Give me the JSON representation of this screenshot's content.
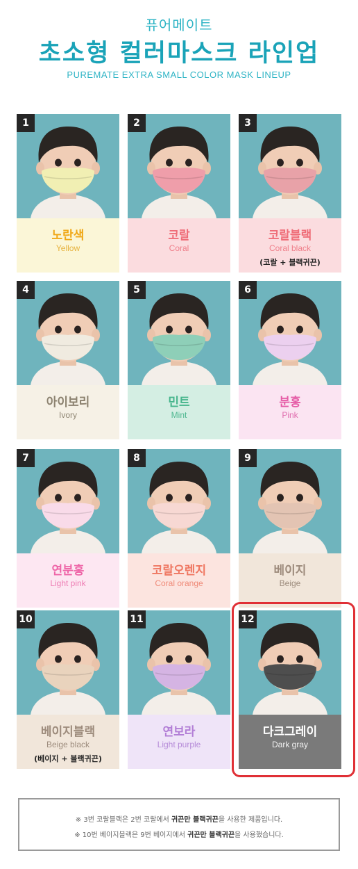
{
  "header": {
    "subtitle": "퓨어메이트",
    "title": "초소형 컬러마스크 라인업",
    "title_en": "PUREMATE EXTRA SMALL COLOR MASK LINEUP"
  },
  "masks": [
    {
      "num": "1",
      "name_ko": "노란색",
      "name_en": "Yellow",
      "note": "",
      "mask_color": "#f1efb3",
      "label_bg": "#fbf6d7",
      "ko_color": "#f0a818",
      "en_color": "#e6b23e"
    },
    {
      "num": "2",
      "name_ko": "코랄",
      "name_en": "Coral",
      "note": "",
      "mask_color": "#ef9eaa",
      "label_bg": "#fbdcdf",
      "ko_color": "#ef6d78",
      "en_color": "#ef7f8a"
    },
    {
      "num": "3",
      "name_ko": "코랄블랙",
      "name_en": "Coral black",
      "note": "(코랄 + 블랙귀끈)",
      "mask_color": "#e8a2a8",
      "label_bg": "#fbdcdf",
      "ko_color": "#ef6d78",
      "en_color": "#ef7f8a"
    },
    {
      "num": "4",
      "name_ko": "아이보리",
      "name_en": "Ivory",
      "note": "",
      "mask_color": "#f0ebe0",
      "label_bg": "#f6f1e6",
      "ko_color": "#8c8270",
      "en_color": "#8f8674"
    },
    {
      "num": "5",
      "name_ko": "민트",
      "name_en": "Mint",
      "note": "",
      "mask_color": "#8ecfb8",
      "label_bg": "#d4eee3",
      "ko_color": "#46b58c",
      "en_color": "#50b891"
    },
    {
      "num": "6",
      "name_ko": "분홍",
      "name_en": "Pink",
      "note": "",
      "mask_color": "#ecd0ef",
      "label_bg": "#fbe4f2",
      "ko_color": "#e55ba6",
      "en_color": "#e06eaf"
    },
    {
      "num": "7",
      "name_ko": "연분홍",
      "name_en": "Light pink",
      "note": "",
      "mask_color": "#f9dbe9",
      "label_bg": "#fde7f2",
      "ko_color": "#ee66a8",
      "en_color": "#ee7db4"
    },
    {
      "num": "8",
      "name_ko": "코랄오렌지",
      "name_en": "Coral orange",
      "note": "",
      "mask_color": "#f7d8d3",
      "label_bg": "#fce4df",
      "ko_color": "#ef7762",
      "en_color": "#ef8a78"
    },
    {
      "num": "9",
      "name_ko": "베이지",
      "name_en": "Beige",
      "note": "",
      "mask_color": "#e3c4b3",
      "label_bg": "#f1e6da",
      "ko_color": "#9d8b7c",
      "en_color": "#9d8c7d"
    },
    {
      "num": "10",
      "name_ko": "베이지블랙",
      "name_en": "Beige black",
      "note": "(베이지 + 블랙귀끈)",
      "mask_color": "#e9d3bd",
      "label_bg": "#f1e6da",
      "ko_color": "#9d8b7c",
      "en_color": "#9d8c7d"
    },
    {
      "num": "11",
      "name_ko": "연보라",
      "name_en": "Light purple",
      "note": "",
      "mask_color": "#d5b4e3",
      "label_bg": "#efe4f8",
      "ko_color": "#b27ed6",
      "en_color": "#b58ad8"
    },
    {
      "num": "12",
      "name_ko": "다크그레이",
      "name_en": "Dark gray",
      "note": "",
      "mask_color": "#4e4e4e",
      "label_bg": "#7a7a7a",
      "ko_color": "#ffffff",
      "en_color": "#f2f2f2"
    }
  ],
  "footer": {
    "line1_a": "※ 3번 코랄블랙은 2번 코랄에서 ",
    "line1_b": "귀끈만 블랙귀끈",
    "line1_c": "을 사용한 제품입니다.",
    "line2_a": "※ 10번 베이지블랙은 9번 베이지에서 ",
    "line2_b": "귀끈만 블랙귀끈",
    "line2_c": "을 사용했습니다."
  }
}
